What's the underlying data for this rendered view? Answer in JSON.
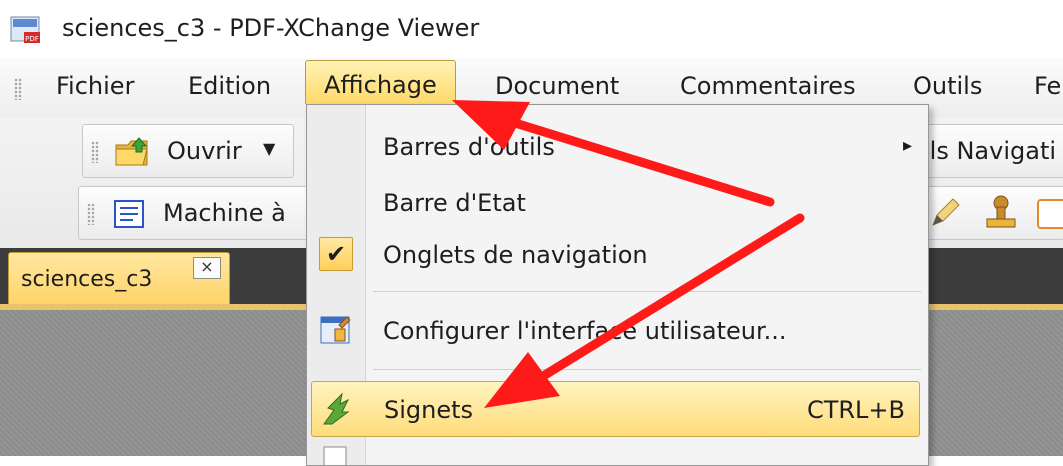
{
  "window": {
    "title": "sciences_c3 - PDF-XChange Viewer"
  },
  "menubar": {
    "items": [
      "Fichier",
      "Edition",
      "Affichage",
      "Document",
      "Commentaires",
      "Outils",
      "Fe"
    ]
  },
  "toolbars": {
    "open_label": "Ouvrir",
    "navigation_label": "ils Navigati",
    "text_tool_label": "Machine à"
  },
  "tabs": {
    "doc_tab_label": "sciences_c3",
    "close_glyph": "×"
  },
  "dropdown": {
    "items": [
      {
        "label": "Barres d'outils",
        "has_submenu": true
      },
      {
        "label": "Barre d'Etat"
      },
      {
        "label": "Onglets de navigation",
        "checked": true
      },
      {
        "label": "Configurer l'interface utilisateur..."
      },
      {
        "label": "Signets",
        "shortcut": "CTRL+B",
        "highlighted": true
      }
    ],
    "check_glyph": "✔",
    "submenu_glyph": "▸"
  },
  "colors": {
    "menu_highlight": "#ffd968",
    "annotation_arrow": "#ff1a1a"
  },
  "icons": [
    "app-pdf-icon",
    "open-folder-icon",
    "dropdown-caret-icon",
    "text-tool-icon",
    "pen-icon",
    "stamp-icon",
    "check-icon",
    "configure-ui-icon",
    "bookmarks-icon"
  ]
}
